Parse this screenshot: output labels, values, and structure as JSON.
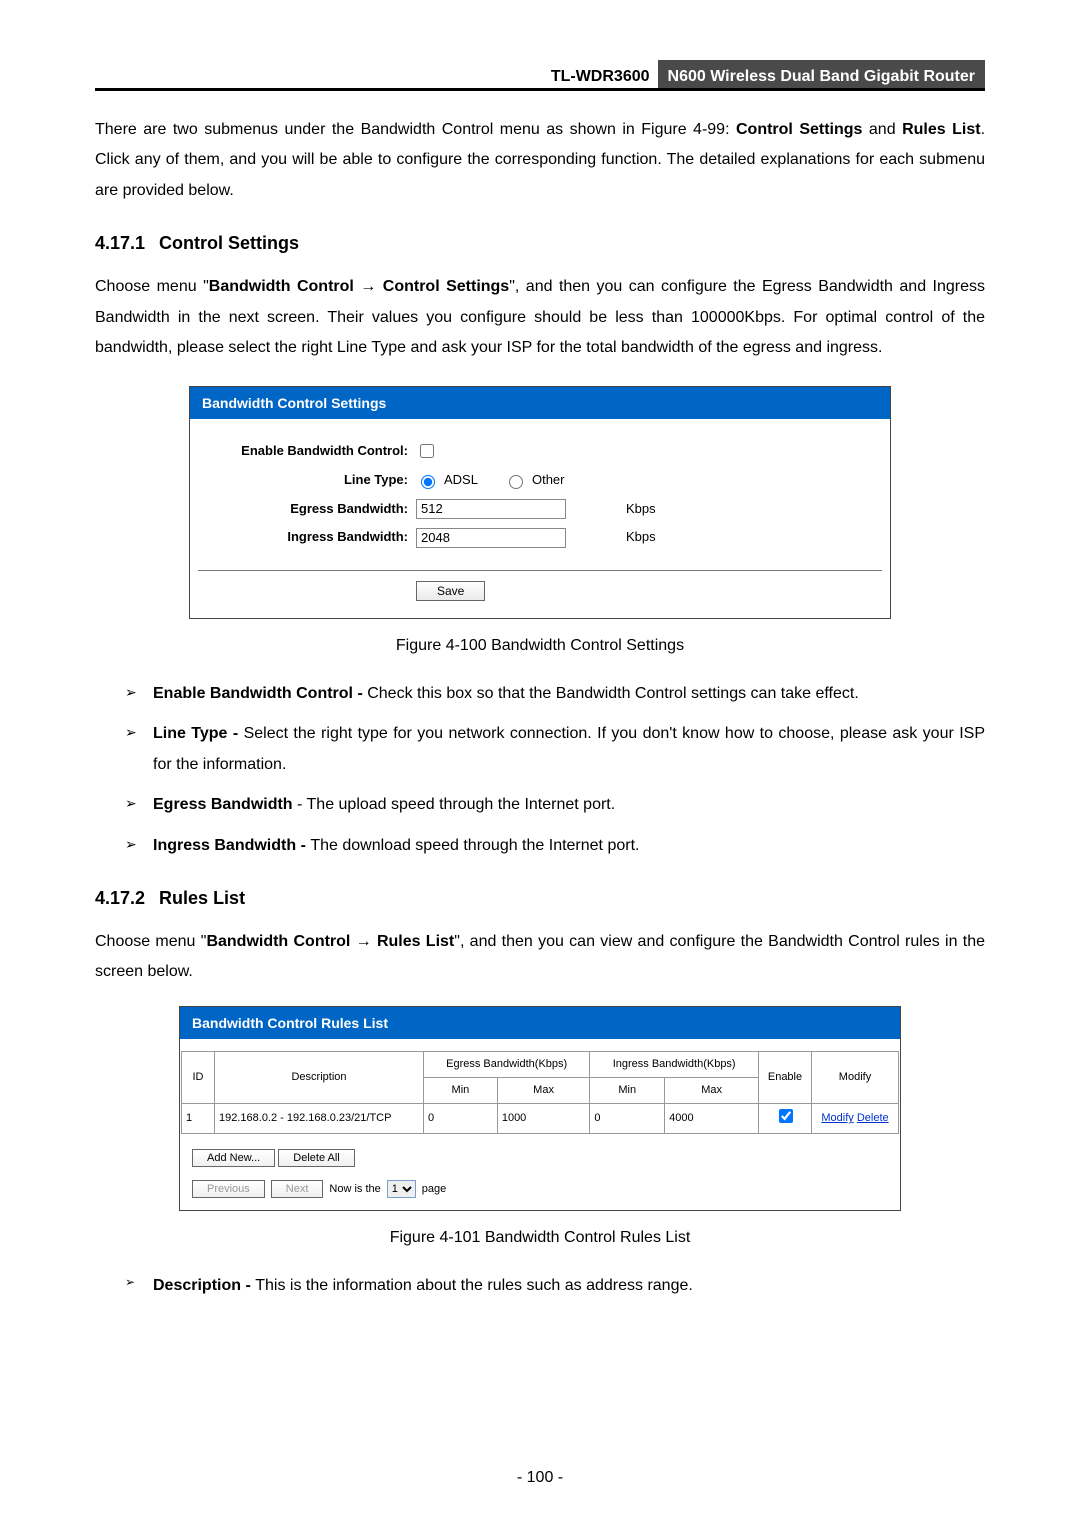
{
  "header": {
    "model": "TL-WDR3600",
    "product": "N600 Wireless Dual Band Gigabit Router"
  },
  "intro": {
    "text_pre": "There are two submenus under the Bandwidth Control menu as shown in Figure 4-99: ",
    "link1": "Control Settings",
    "text_mid1": " and ",
    "link2": "Rules List",
    "text_post": ". Click any of them, and you will be able to configure the corresponding function. The detailed explanations for each submenu are provided below."
  },
  "sec1": {
    "num": "4.17.1",
    "title": "Control Settings",
    "para_a": "Choose menu \"",
    "para_b": "Bandwidth Control",
    "para_c": " → ",
    "para_d": "Control Settings",
    "para_e": "\", and then you can configure the Egress Bandwidth and Ingress Bandwidth in the next screen. Their values you configure should be less than 100000Kbps. For optimal control of the bandwidth, please select the right Line Type and ask your ISP for the total bandwidth of the egress and ingress."
  },
  "fig1": {
    "panel_title": "Bandwidth Control Settings",
    "labels": {
      "enable": "Enable Bandwidth Control:",
      "line_type": "Line Type:",
      "egress": "Egress Bandwidth:",
      "ingress": "Ingress Bandwidth:"
    },
    "line_adsl": "ADSL",
    "line_other": "Other",
    "egress_value": "512",
    "ingress_value": "2048",
    "unit": "Kbps",
    "save": "Save",
    "caption": "Figure 4-100 Bandwidth Control Settings"
  },
  "bullets1": [
    {
      "term": "Enable Bandwidth Control - ",
      "desc": "Check this box so that the Bandwidth Control settings can take effect."
    },
    {
      "term": "Line Type - ",
      "desc": "Select the right type for you network connection. If you don't know how to choose, please ask your ISP for the information."
    },
    {
      "term": "Egress Bandwidth ",
      "desc": "- The upload speed through the Internet port."
    },
    {
      "term": "Ingress Bandwidth - ",
      "desc": "The download speed through the Internet port."
    }
  ],
  "sec2": {
    "num": "4.17.2",
    "title": "Rules List",
    "para_a": "Choose menu \"",
    "para_b": "Bandwidth Control",
    "para_c": " → ",
    "para_d": "Rules List",
    "para_e": "\", and then you can view and configure the Bandwidth Control rules in the screen below."
  },
  "fig2": {
    "panel_title": "Bandwidth Control Rules List",
    "head": {
      "id": "ID",
      "desc": "Description",
      "egress": "Egress Bandwidth(Kbps)",
      "ingress": "Ingress Bandwidth(Kbps)",
      "min": "Min",
      "max": "Max",
      "enable": "Enable",
      "modify": "Modify"
    },
    "row1": {
      "id": "1",
      "desc": "192.168.0.2 - 192.168.0.23/21/TCP",
      "emin": "0",
      "emax": "1000",
      "imin": "0",
      "imax": "4000",
      "modify": "Modify",
      "delete": "Delete"
    },
    "btn_add": "Add New...",
    "btn_delall": "Delete All",
    "btn_prev": "Previous",
    "btn_next": "Next",
    "pager_pre": "Now is the",
    "pager_val": "1",
    "pager_post": "page",
    "caption": "Figure 4-101 Bandwidth Control Rules List"
  },
  "bullets2": [
    {
      "term": "Description - ",
      "desc": "This is the information about the rules such as address range."
    }
  ],
  "page_number": "- 100 -"
}
